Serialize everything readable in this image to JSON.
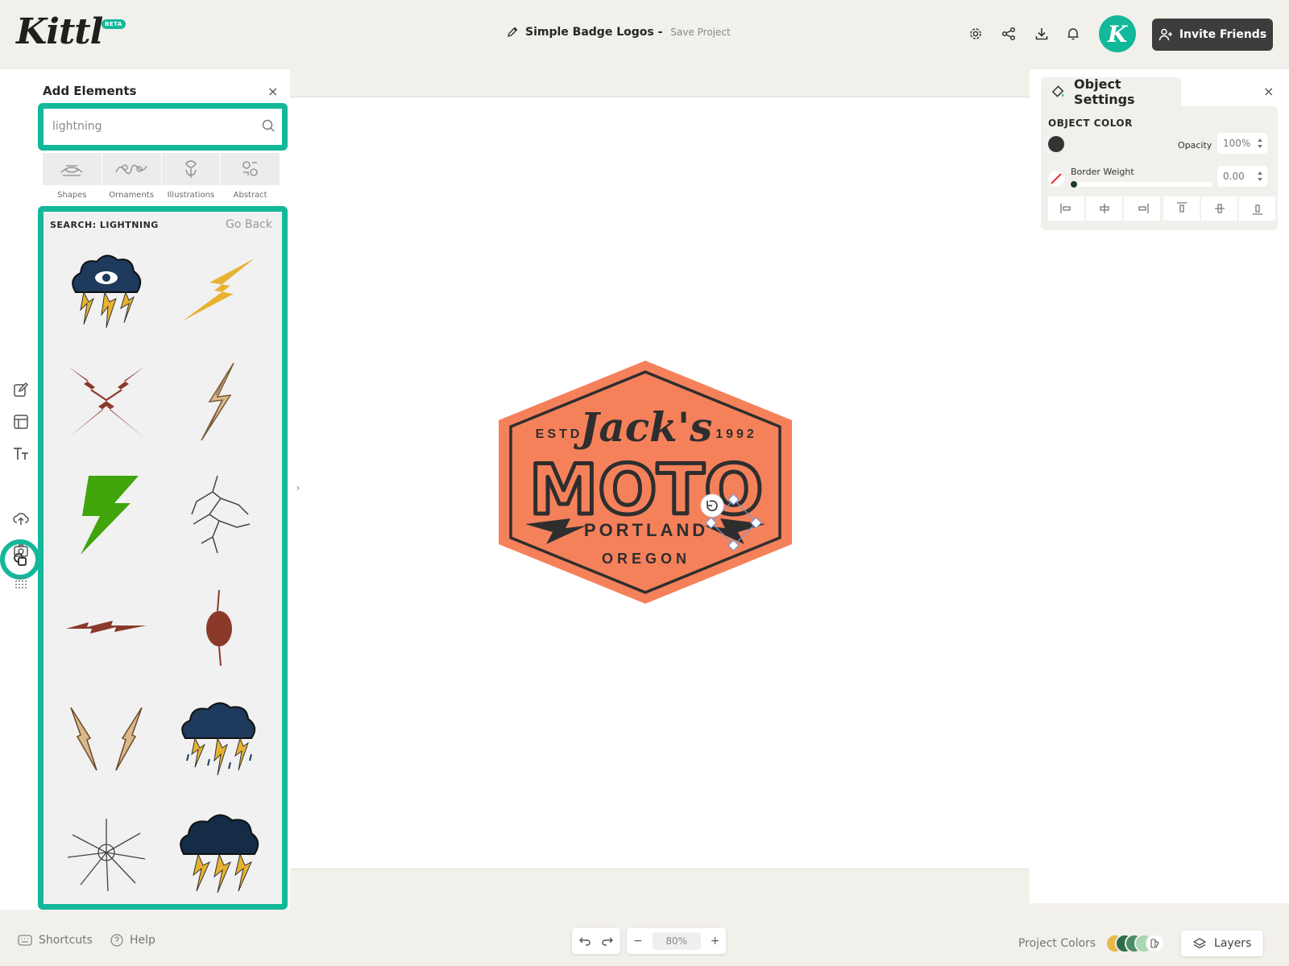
{
  "brand": {
    "logo": "Kittl",
    "badge": "BETA"
  },
  "header": {
    "project_name": "Simple Badge Logos -",
    "save_label": "Save Project",
    "avatar_letter": "K",
    "invite_label": "Invite Friends"
  },
  "add_elements": {
    "title": "Add Elements",
    "close_symbol": "×",
    "search_value": "lightning",
    "categories": [
      {
        "label": "Shapes",
        "icon": "shapes-icon"
      },
      {
        "label": "Ornaments",
        "icon": "ornaments-icon"
      },
      {
        "label": "Illustrations",
        "icon": "illustrations-icon"
      },
      {
        "label": "Abstract",
        "icon": "abstract-icon"
      }
    ],
    "results_heading": "SEARCH: LIGHTNING",
    "go_back": "Go Back",
    "results": [
      "storm-cloud-eye",
      "lightning-bolt-yellow",
      "crossed-bolts-red",
      "lightning-bolt-sketch",
      "lightning-bolt-green",
      "lightning-strike-lines",
      "lightning-bolt-horizontal",
      "lightning-orb-red",
      "lightning-wings",
      "storm-cloud-rain",
      "lightning-burst",
      "storm-cloud-dark"
    ],
    "toggle_symbol": "›"
  },
  "badge": {
    "estd": "ESTD",
    "year": "1992",
    "script": "Jack's",
    "main": "MOTO",
    "city": "PORTLAND",
    "state": "OREGON",
    "fill_color": "#f5815b",
    "ink_color": "#2e2e2e"
  },
  "object_settings": {
    "title": "Object Settings",
    "close_symbol": "×",
    "object_color_label": "OBJECT COLOR",
    "object_color": "#333333",
    "opacity_label": "Opacity",
    "opacity_value": "100%",
    "border_label": "Border Weight",
    "border_value": "0.00",
    "border_weight": 0
  },
  "bottom": {
    "shortcuts": "Shortcuts",
    "help": "Help",
    "zoom": "80%",
    "zoom_out": "−",
    "zoom_in": "+",
    "project_colors_label": "Project Colors",
    "project_colors": [
      "#e8b84a",
      "#2e6b4a",
      "#4a8f65",
      "#a9d6b4"
    ],
    "layers": "Layers"
  },
  "colors": {
    "accent": "#13b89a",
    "dark_button": "#3d3d3d"
  }
}
